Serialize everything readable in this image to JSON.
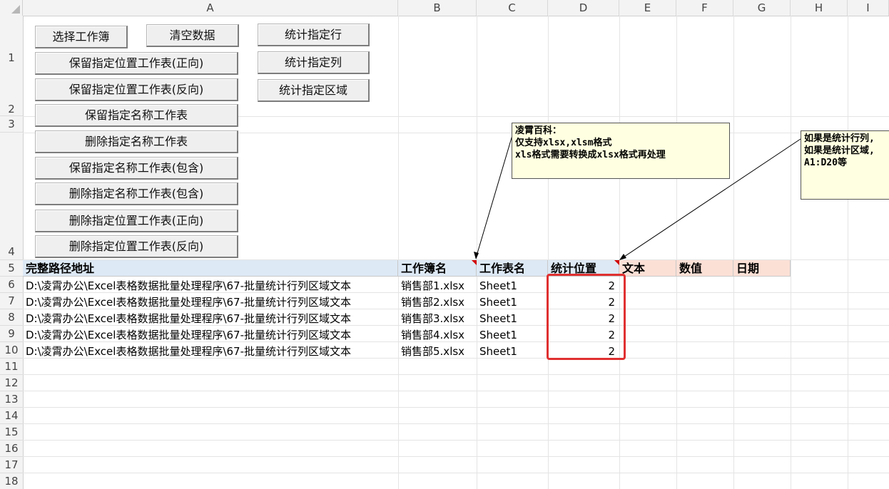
{
  "columns": [
    "A",
    "B",
    "C",
    "D",
    "E",
    "F",
    "G",
    "H",
    "I"
  ],
  "rows": [
    "1",
    "2",
    "3",
    "4",
    "5",
    "6",
    "7",
    "8",
    "9",
    "10",
    "11",
    "12",
    "13",
    "14",
    "15",
    "16",
    "17",
    "18"
  ],
  "buttons": {
    "select_workbook": "选择工作簿",
    "clear_data": "清空数据",
    "count_rows": "统计指定行",
    "count_cols": "统计指定列",
    "count_range": "统计指定区域",
    "keep_pos_fwd": "保留指定位置工作表(正向)",
    "keep_pos_rev": "保留指定位置工作表(反向)",
    "keep_name": "保留指定名称工作表",
    "delete_name": "删除指定名称工作表",
    "keep_name_contains": "保留指定名称工作表(包含)",
    "delete_name_contains": "删除指定名称工作表(包含)",
    "delete_pos_fwd": "删除指定位置工作表(正向)",
    "delete_pos_rev": "删除指定位置工作表(反向)"
  },
  "headers": {
    "path": "完整路径地址",
    "workbook": "工作簿名",
    "sheet": "工作表名",
    "position": "统计位置",
    "text": "文本",
    "number": "数值",
    "date": "日期"
  },
  "data_rows": [
    {
      "path": "D:\\凌霄办公\\Excel表格数据批量处理程序\\67-批量统计行列区域文本",
      "workbook": "销售部1.xlsx",
      "sheet": "Sheet1",
      "position": "2"
    },
    {
      "path": "D:\\凌霄办公\\Excel表格数据批量处理程序\\67-批量统计行列区域文本",
      "workbook": "销售部2.xlsx",
      "sheet": "Sheet1",
      "position": "2"
    },
    {
      "path": "D:\\凌霄办公\\Excel表格数据批量处理程序\\67-批量统计行列区域文本",
      "workbook": "销售部3.xlsx",
      "sheet": "Sheet1",
      "position": "2"
    },
    {
      "path": "D:\\凌霄办公\\Excel表格数据批量处理程序\\67-批量统计行列区域文本",
      "workbook": "销售部4.xlsx",
      "sheet": "Sheet1",
      "position": "2"
    },
    {
      "path": "D:\\凌霄办公\\Excel表格数据批量处理程序\\67-批量统计行列区域文本",
      "workbook": "销售部5.xlsx",
      "sheet": "Sheet1",
      "position": "2"
    }
  ],
  "comments": {
    "workbook_note": "凌霄百科：\n仅支持xlsx,xlsm格式\nxls格式需要转换成xlsx格式再处理",
    "position_note": "如果是统计行列,\n如果是统计区域,\nA1:D20等"
  },
  "colors": {
    "header_blue": "#dde9f5",
    "header_pink": "#fbe0d6",
    "selection_red": "#e03030",
    "comment_bg": "#ffffe1"
  }
}
